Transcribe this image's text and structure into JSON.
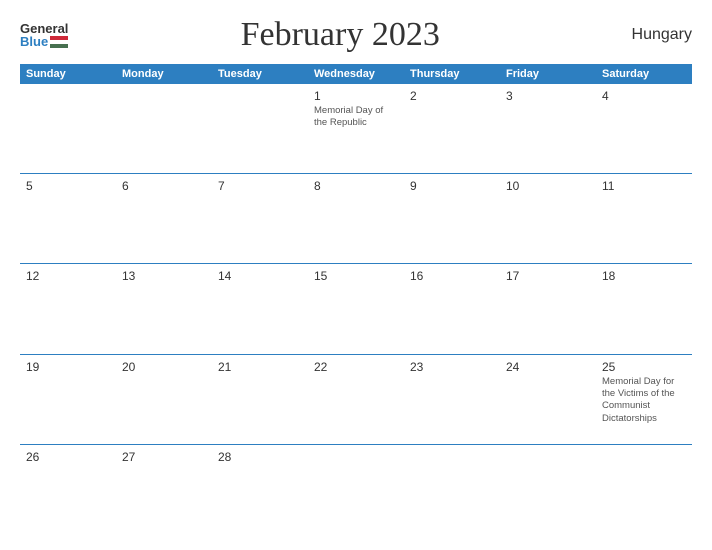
{
  "header": {
    "logo_general": "General",
    "logo_blue": "Blue",
    "title": "February 2023",
    "country": "Hungary"
  },
  "calendar": {
    "days_of_week": [
      "Sunday",
      "Monday",
      "Tuesday",
      "Wednesday",
      "Thursday",
      "Friday",
      "Saturday"
    ],
    "weeks": [
      [
        {
          "day": "",
          "empty": true
        },
        {
          "day": "",
          "empty": true
        },
        {
          "day": "",
          "empty": true
        },
        {
          "day": "1",
          "event": "Memorial Day of the Republic"
        },
        {
          "day": "2",
          "event": ""
        },
        {
          "day": "3",
          "event": ""
        },
        {
          "day": "4",
          "event": ""
        }
      ],
      [
        {
          "day": "5",
          "event": ""
        },
        {
          "day": "6",
          "event": ""
        },
        {
          "day": "7",
          "event": ""
        },
        {
          "day": "8",
          "event": ""
        },
        {
          "day": "9",
          "event": ""
        },
        {
          "day": "10",
          "event": ""
        },
        {
          "day": "11",
          "event": ""
        }
      ],
      [
        {
          "day": "12",
          "event": ""
        },
        {
          "day": "13",
          "event": ""
        },
        {
          "day": "14",
          "event": ""
        },
        {
          "day": "15",
          "event": ""
        },
        {
          "day": "16",
          "event": ""
        },
        {
          "day": "17",
          "event": ""
        },
        {
          "day": "18",
          "event": ""
        }
      ],
      [
        {
          "day": "19",
          "event": ""
        },
        {
          "day": "20",
          "event": ""
        },
        {
          "day": "21",
          "event": ""
        },
        {
          "day": "22",
          "event": ""
        },
        {
          "day": "23",
          "event": ""
        },
        {
          "day": "24",
          "event": ""
        },
        {
          "day": "25",
          "event": "Memorial Day for the Victims of the Communist Dictatorships"
        }
      ],
      [
        {
          "day": "26",
          "event": ""
        },
        {
          "day": "27",
          "event": ""
        },
        {
          "day": "28",
          "event": ""
        },
        {
          "day": "",
          "empty": true
        },
        {
          "day": "",
          "empty": true
        },
        {
          "day": "",
          "empty": true
        },
        {
          "day": "",
          "empty": true
        }
      ]
    ]
  }
}
